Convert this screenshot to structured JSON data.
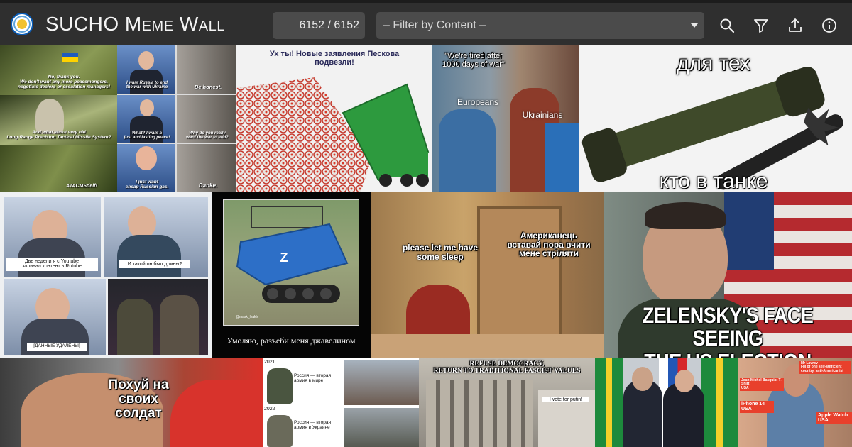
{
  "header": {
    "app_title": "SUCHO Meme Wall",
    "counter": "6152 / 6152",
    "filter_label": "– Filter by Content –",
    "icons": [
      "search-icon",
      "filter-icon",
      "upload-icon",
      "info-icon"
    ]
  },
  "memes": {
    "gandalf": {
      "top": "No, thank you.\nWe don't want any more peacemongers,\nnegotiate dealers or escalation managers!",
      "middle": "And what about very old\nLong-Range Precision Tactical Missile System?",
      "bottom": "ATACMSdelf!"
    },
    "scholz": {
      "p1_left": "I want Russia to end\nthe war with Ukraine",
      "p1_right": "Be honest.",
      "p2_left": "What? I want a\njust and lasting peace!",
      "p2_right": "Why do you really\nwant the war to end?",
      "p3_left": "I just want\ncheap Russian gas.",
      "p3_right": "Danke."
    },
    "peskov": {
      "caption": "Ух ты! Новые заявления Пескова\nподвезли!"
    },
    "europeans": {
      "top": "\"We're tired after\n1000 days of war\"",
      "left": "Europeans",
      "right": "Ukrainians"
    },
    "javelin": {
      "top": "для тех",
      "bottom": "кто в танке"
    },
    "singer": {
      "p1": "Две недели я с Youtube\nзаливал контент в Rutube",
      "p2": "И какой он был длины?",
      "p3": "[ДАННЫЕ УДАЛЕНЫ]"
    },
    "robot_tank": {
      "caption": "Умоляю, разъеби меня джавелином",
      "mark": "Z",
      "watermark": "@mask_lvaklx"
    },
    "sleep": {
      "left": "please let me have\nsome sleep",
      "right": "Американець\nвставай пора вчити\nмене стріляти"
    },
    "zelensky": {
      "caption": "ZELENSKY'S FACE SEEING\nTHE US ELECTION RESULTS"
    },
    "armwrestle": {
      "caption": "Похуй на\nсвоих\nсолдат"
    },
    "army": {
      "year1": "2021",
      "text1": "Россия — вторая\nармия в мире",
      "year2": "2022",
      "text2": "Россия — вторая\nармия в Украине"
    },
    "fascist": {
      "caption": "REFUSE DEMOCRACY,\nRETURN TO TRADITIONAL FASCIST VALUES",
      "sign": "I vote for putin!"
    },
    "lavrov": {
      "tag1": "Jean-Michel Basquiat T-Shirt\nUSA",
      "tag2": "Mr Lavrov\nFM of one self-sufficient\ncountry, anti-Americanist",
      "tag3": "iPhone 14\nUSA",
      "tag4": "Apple Watch\nUSA"
    }
  }
}
